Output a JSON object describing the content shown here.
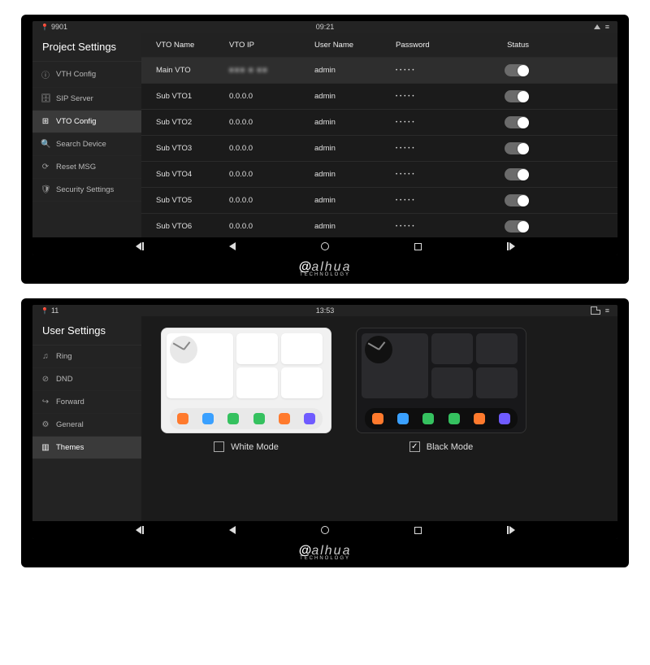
{
  "brand": "alhua",
  "brand_sub": "TECHNOLOGY",
  "device1": {
    "statusbar": {
      "left_label": "9901",
      "time": "09:21"
    },
    "sidebar_title": "Project Settings",
    "sidebar": [
      {
        "icon": "ⓘ",
        "label": "VTH Config"
      },
      {
        "icon": "🗄",
        "label": "SIP Server"
      },
      {
        "icon": "⊞",
        "label": "VTO Config",
        "active": true
      },
      {
        "icon": "🔍",
        "label": "Search Device"
      },
      {
        "icon": "⟳",
        "label": "Reset MSG"
      },
      {
        "icon": "🛡",
        "label": "Security Settings"
      }
    ],
    "columns": {
      "name": "VTO Name",
      "ip": "VTO IP",
      "user": "User Name",
      "pwd": "Password",
      "status": "Status"
    },
    "rows": [
      {
        "name": "Main VTO",
        "ip": "■■■ ■ ■■",
        "ip_blur": true,
        "user": "admin",
        "pwd": "•••••",
        "on": true,
        "sel": true
      },
      {
        "name": "Sub VTO1",
        "ip": "0.0.0.0",
        "user": "admin",
        "pwd": "•••••",
        "on": true
      },
      {
        "name": "Sub VTO2",
        "ip": "0.0.0.0",
        "user": "admin",
        "pwd": "•••••",
        "on": true
      },
      {
        "name": "Sub VTO3",
        "ip": "0.0.0.0",
        "user": "admin",
        "pwd": "•••••",
        "on": true
      },
      {
        "name": "Sub VTO4",
        "ip": "0.0.0.0",
        "user": "admin",
        "pwd": "•••••",
        "on": true
      },
      {
        "name": "Sub VTO5",
        "ip": "0.0.0.0",
        "user": "admin",
        "pwd": "•••••",
        "on": true
      },
      {
        "name": "Sub VTO6",
        "ip": "0.0.0.0",
        "user": "admin",
        "pwd": "•••••",
        "on": true
      }
    ]
  },
  "device2": {
    "statusbar": {
      "left_label": "11",
      "time": "13:53"
    },
    "sidebar_title": "User Settings",
    "sidebar": [
      {
        "icon": "♫",
        "label": "Ring"
      },
      {
        "icon": "⊘",
        "label": "DND"
      },
      {
        "icon": "↪",
        "label": "Forward"
      },
      {
        "icon": "⚙",
        "label": "General"
      },
      {
        "icon": "▥",
        "label": "Themes",
        "active": true
      }
    ],
    "themes": {
      "white_label": "White Mode",
      "black_label": "Black Mode",
      "white_selected": false,
      "black_selected": true,
      "dock_colors": [
        "#ff7a2d",
        "#3aa0ff",
        "#35c15f",
        "#35c15f",
        "#ff7a2d",
        "#6f5bff"
      ]
    }
  }
}
